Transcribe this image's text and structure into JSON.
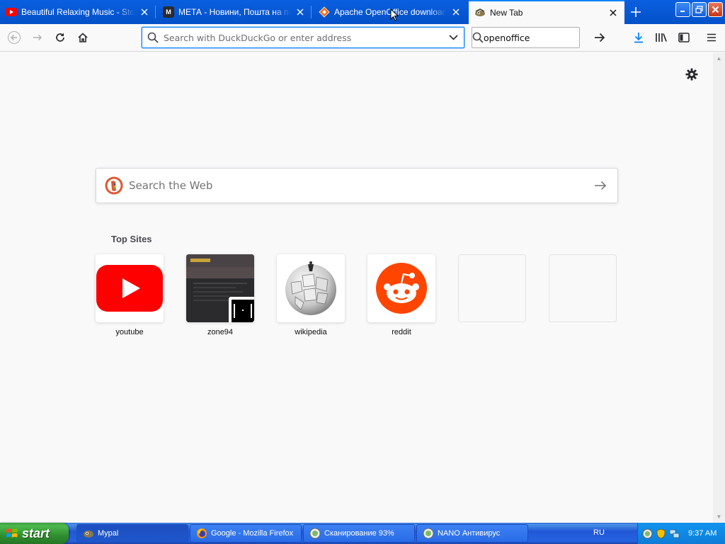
{
  "tabs": [
    {
      "title": "Beautiful Relaxing Music - Stop Overthinking",
      "favicon": "youtube-icon",
      "active": false
    },
    {
      "title": "МЕТА - Новини, Пошта на порталі",
      "favicon": "meta-m-icon",
      "favicon_text": "M",
      "active": false
    },
    {
      "title": "Apache OpenOffice download | SourceForge",
      "favicon": "sourceforge-diamond-icon",
      "active": false
    },
    {
      "title": "New Tab",
      "favicon": "firefox-newtab-icon",
      "active": true
    }
  ],
  "urlbar": {
    "placeholder": "Search with DuckDuckGo or enter address",
    "value": ""
  },
  "searchbar": {
    "value": "openoffice"
  },
  "newtab": {
    "search_placeholder": "Search the Web",
    "top_sites_title": "Top Sites",
    "top_sites": [
      {
        "label": "youtube",
        "icon": "youtube-icon"
      },
      {
        "label": "zone94",
        "icon": "zone94-thumbnail"
      },
      {
        "label": "wikipedia",
        "icon": "wikipedia-globe-icon"
      },
      {
        "label": "reddit",
        "icon": "reddit-alien-icon"
      },
      {
        "label": "",
        "icon": ""
      },
      {
        "label": "",
        "icon": ""
      }
    ]
  },
  "taskbar": {
    "start_label": "start",
    "items": [
      {
        "label": "Mypal",
        "icon": "mypal-icon",
        "pressed": true
      },
      {
        "label": "Google - Mozilla Firefox",
        "icon": "firefox-icon",
        "pressed": false
      },
      {
        "label": "Сканирование 93%",
        "icon": "nano-antivirus-icon",
        "pressed": false
      },
      {
        "label": "NANO Антивирус",
        "icon": "nano-antivirus-icon",
        "pressed": false
      }
    ],
    "language": "RU",
    "clock": "9:37 AM"
  },
  "colors": {
    "tabstrip": "#0a5fe0",
    "accent": "#0a84ff",
    "youtube_red": "#ff0000",
    "reddit_orange": "#ff4500",
    "ddg_orange": "#de5833",
    "taskbar_blue": "#2157d7",
    "start_green": "#3c9d3c"
  }
}
